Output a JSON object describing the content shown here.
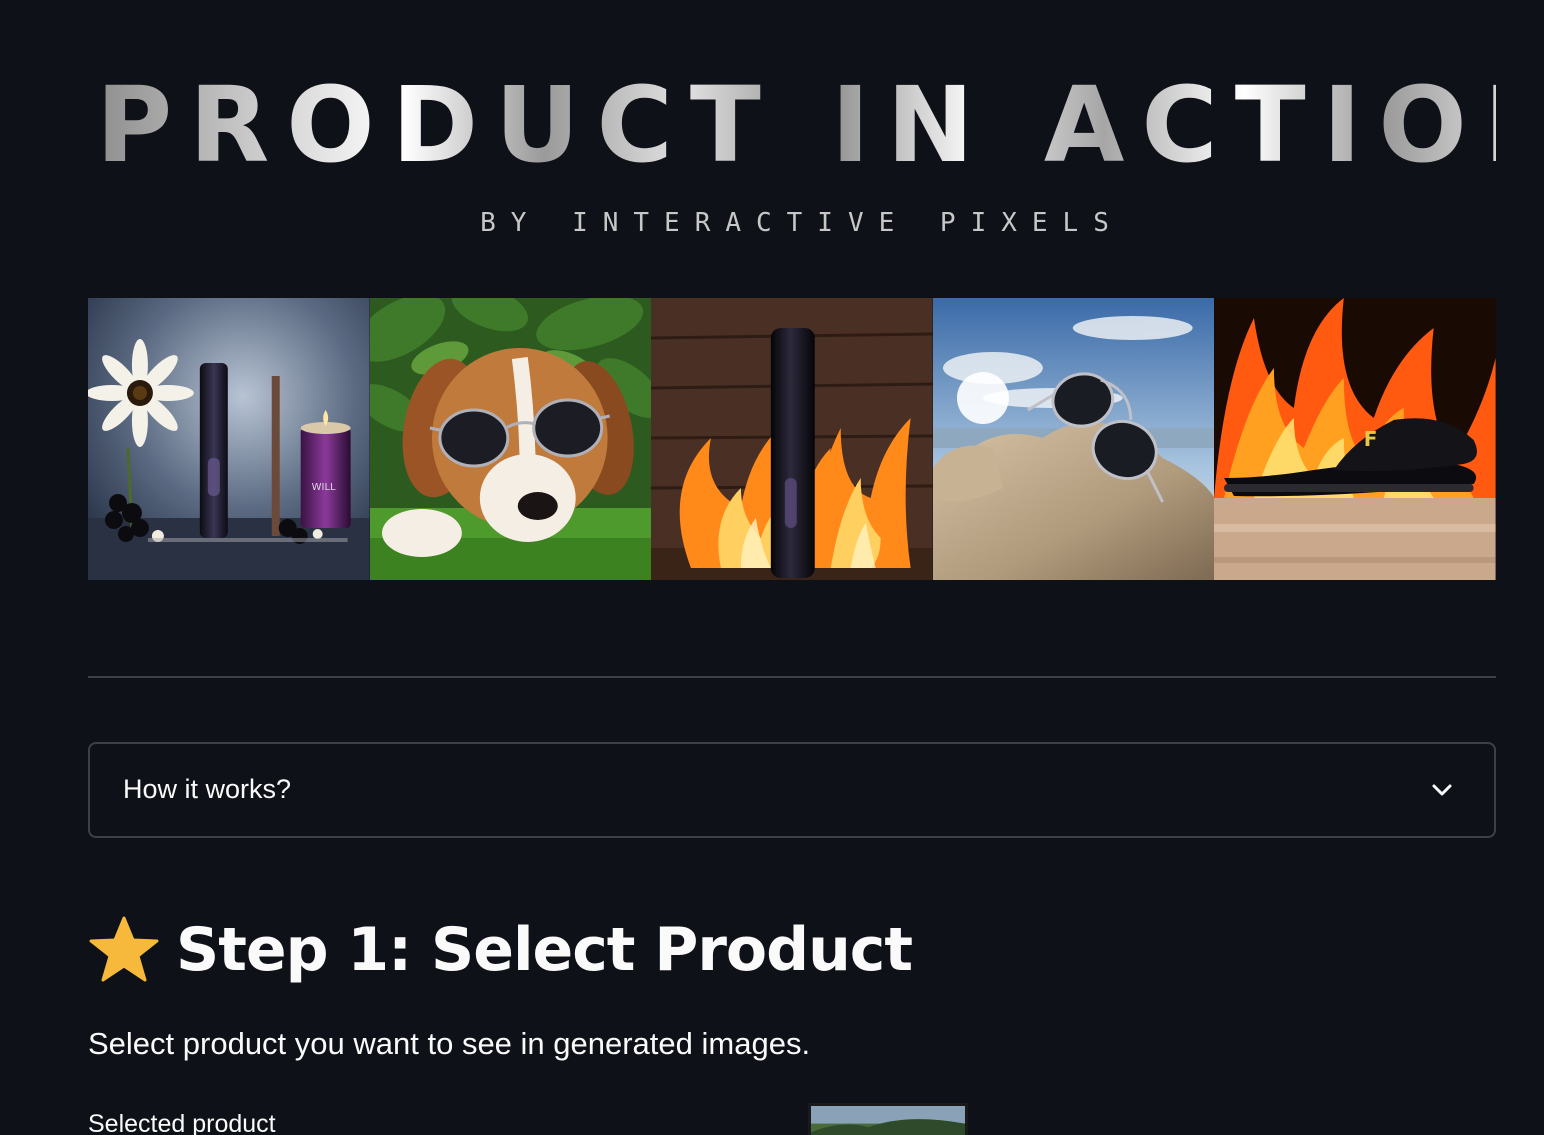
{
  "logo": {
    "title": "PRODUCT IN ACTION",
    "subtitle": "BY INTERACTIVE PIXELS"
  },
  "gallery": {
    "items": [
      {
        "name": "perfume-flower-candle",
        "alt": "Perfume bottles with flower and candle"
      },
      {
        "name": "dog-sunglasses",
        "alt": "Dog wearing sunglasses"
      },
      {
        "name": "bottle-fire",
        "alt": "Black bottle in fire"
      },
      {
        "name": "sunglasses-rock",
        "alt": "Sunglasses on rock"
      },
      {
        "name": "slide-fire",
        "alt": "Black slide sandal with flames"
      }
    ],
    "slide_logo": "F",
    "candle_label": "WILL"
  },
  "expander": {
    "label": "How it works?"
  },
  "step1": {
    "icon": "star-icon",
    "title": "Step 1: Select Product",
    "description": "Select product you want to see in generated images.",
    "selected_label": "Selected product"
  },
  "colors": {
    "background": "#0e1117",
    "text": "#fafafa",
    "border": "#3d4049",
    "star": "#f6b93b"
  }
}
